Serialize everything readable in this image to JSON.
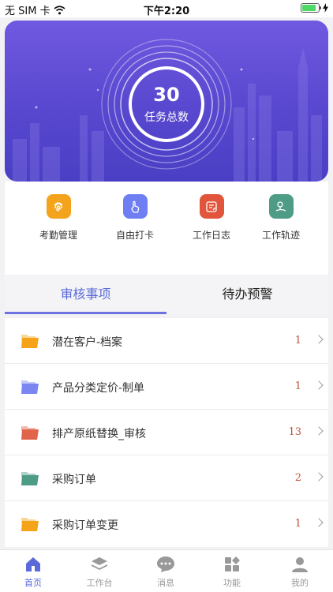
{
  "status_bar": {
    "carrier": "无 SIM 卡",
    "time": "下午2:20",
    "battery_level": 0.85
  },
  "hero": {
    "count": "30",
    "label": "任务总数"
  },
  "quick_actions": [
    {
      "label": "考勤管理",
      "icon": "fingerprint-icon",
      "color": "#f4a31c"
    },
    {
      "label": "自由打卡",
      "icon": "tap-hand-icon",
      "color": "#6f7ef2"
    },
    {
      "label": "工作日志",
      "icon": "edit-note-icon",
      "color": "#e0553b"
    },
    {
      "label": "工作轨迹",
      "icon": "location-track-icon",
      "color": "#4e9b86"
    }
  ],
  "tabs": {
    "active": "审核事项",
    "other": "待办预警"
  },
  "items": [
    {
      "title": "潜在客户-档案",
      "count": "1",
      "folder_color": "#f5a319"
    },
    {
      "title": "产品分类定价-制单",
      "count": "1",
      "folder_color": "#7b86f2"
    },
    {
      "title": "排产原纸替换_审核",
      "count": "13",
      "folder_color": "#e0634a"
    },
    {
      "title": "采购订单",
      "count": "2",
      "folder_color": "#4e9b86"
    },
    {
      "title": "采购订单变更",
      "count": "1",
      "folder_color": "#f5a319"
    }
  ],
  "bottom_nav": [
    {
      "label": "首页",
      "icon": "home-icon"
    },
    {
      "label": "工作台",
      "icon": "layers-icon"
    },
    {
      "label": "消息",
      "icon": "chat-icon"
    },
    {
      "label": "功能",
      "icon": "apps-icon"
    },
    {
      "label": "我的",
      "icon": "user-icon"
    }
  ],
  "colors": {
    "accent": "#5a6ad8",
    "count_red": "#c0533a",
    "hero_top": "#7059e0",
    "hero_bottom": "#4a3fc4"
  }
}
